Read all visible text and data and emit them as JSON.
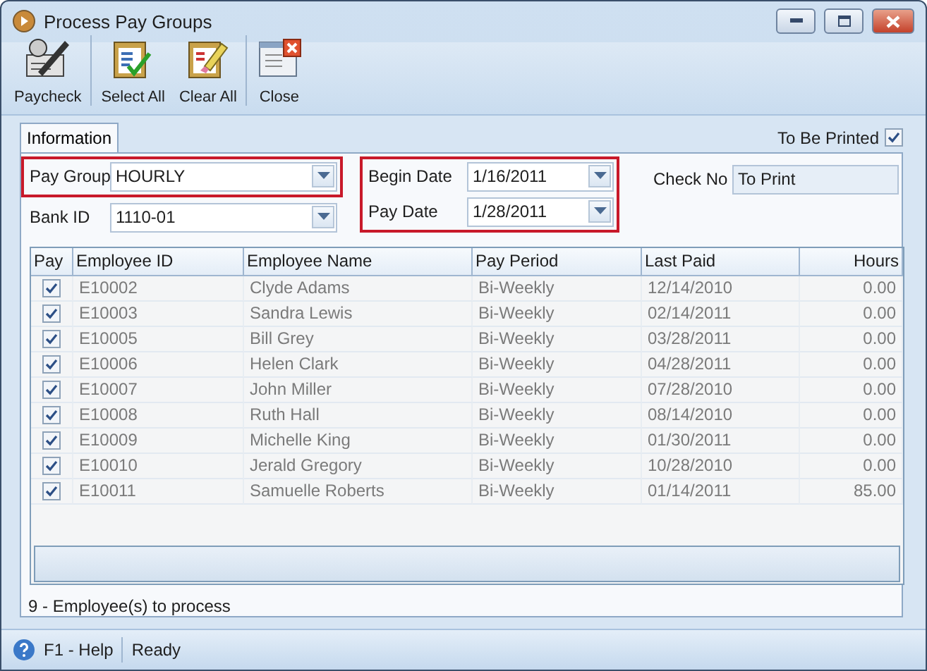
{
  "window": {
    "title": "Process Pay Groups"
  },
  "toolbar": [
    {
      "label": "Paycheck",
      "kind": "paycheck",
      "separator_after": true
    },
    {
      "label": "Select All",
      "kind": "select_all",
      "separator_after": false
    },
    {
      "label": "Clear All",
      "kind": "clear_all",
      "separator_after": true
    },
    {
      "label": "Close",
      "kind": "close",
      "separator_after": false
    }
  ],
  "tabs": [
    {
      "label": "Information",
      "selected": true
    }
  ],
  "to_be_printed": {
    "label": "To Be Printed",
    "checked": true
  },
  "field_columns": [
    {
      "groups": [
        {
          "highlighted": true,
          "fields": [
            {
              "label": "Pay Group",
              "value": "HOURLY",
              "kind": "dropdown"
            }
          ]
        },
        {
          "highlighted": false,
          "fields": [
            {
              "label": "Bank ID",
              "value": "1110-01",
              "kind": "dropdown"
            }
          ]
        }
      ]
    },
    {
      "groups": [
        {
          "highlighted": true,
          "fields": [
            {
              "label": "Begin Date",
              "value": "1/16/2011",
              "kind": "date"
            },
            {
              "label": "Pay Date",
              "value": "1/28/2011",
              "kind": "date"
            }
          ]
        }
      ]
    },
    {
      "groups": [
        {
          "highlighted": false,
          "fields": [
            {
              "label": "Check No",
              "value": "To Print",
              "kind": "text"
            }
          ]
        }
      ]
    }
  ],
  "table": {
    "columns": [
      "Pay",
      "Employee ID",
      "Employee Name",
      "Pay Period",
      "Last Paid",
      "Hours"
    ],
    "rows": [
      {
        "pay": true,
        "id": "E10002",
        "name": "Clyde Adams",
        "period": "Bi-Weekly",
        "last_paid": "12/14/2010",
        "hours": "0.00"
      },
      {
        "pay": true,
        "id": "E10003",
        "name": "Sandra Lewis",
        "period": "Bi-Weekly",
        "last_paid": "02/14/2011",
        "hours": "0.00"
      },
      {
        "pay": true,
        "id": "E10005",
        "name": "Bill Grey",
        "period": "Bi-Weekly",
        "last_paid": "03/28/2011",
        "hours": "0.00"
      },
      {
        "pay": true,
        "id": "E10006",
        "name": "Helen Clark",
        "period": "Bi-Weekly",
        "last_paid": "04/28/2011",
        "hours": "0.00"
      },
      {
        "pay": true,
        "id": "E10007",
        "name": "John Miller",
        "period": "Bi-Weekly",
        "last_paid": "07/28/2010",
        "hours": "0.00"
      },
      {
        "pay": true,
        "id": "E10008",
        "name": "Ruth Hall",
        "period": "Bi-Weekly",
        "last_paid": "08/14/2010",
        "hours": "0.00"
      },
      {
        "pay": true,
        "id": "E10009",
        "name": "Michelle King",
        "period": "Bi-Weekly",
        "last_paid": "01/30/2011",
        "hours": "0.00"
      },
      {
        "pay": true,
        "id": "E10010",
        "name": "Jerald Gregory",
        "period": "Bi-Weekly",
        "last_paid": "10/28/2010",
        "hours": "0.00"
      },
      {
        "pay": true,
        "id": "E10011",
        "name": "Samuelle Roberts",
        "period": "Bi-Weekly",
        "last_paid": "01/14/2011",
        "hours": "85.00"
      }
    ]
  },
  "summary": "9 -  Employee(s) to process",
  "status_bar": {
    "help": "F1 - Help",
    "status": "Ready"
  }
}
